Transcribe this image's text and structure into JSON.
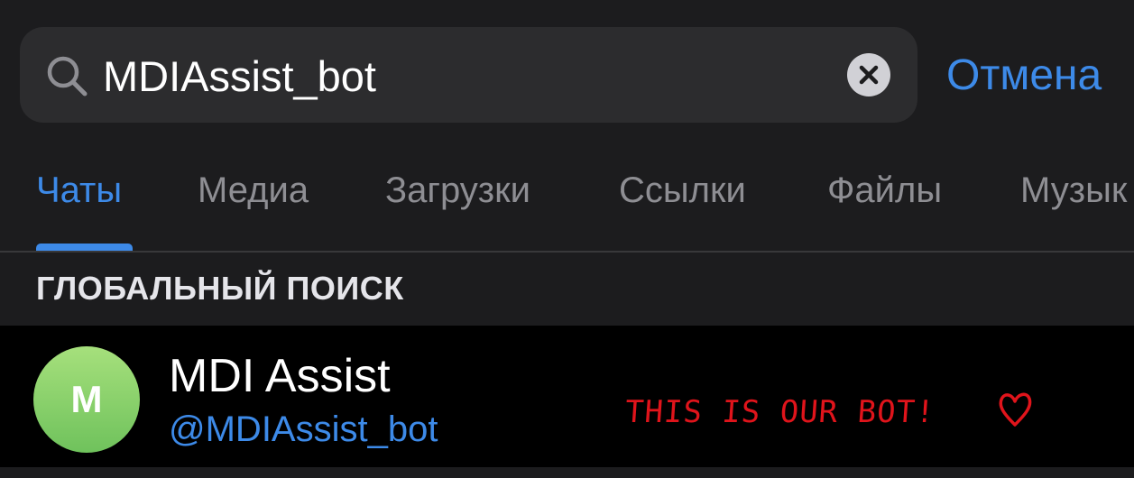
{
  "search": {
    "query": "MDIAssist_bot",
    "cancel_label": "Отмена"
  },
  "tabs": [
    {
      "label": "Чаты",
      "active": true
    },
    {
      "label": "Медиа",
      "active": false
    },
    {
      "label": "Загрузки",
      "active": false
    },
    {
      "label": "Ссылки",
      "active": false
    },
    {
      "label": "Файлы",
      "active": false
    },
    {
      "label": "Музык",
      "active": false
    }
  ],
  "section": {
    "title": "ГЛОБАЛЬНЫЙ ПОИСК"
  },
  "result": {
    "avatar_letter": "M",
    "title": "MDI Assist",
    "username": "@MDIAssist_bot",
    "annotation": "THIS IS OUR BOT!"
  },
  "colors": {
    "accent": "#3d8ae8",
    "background": "#1c1c1e",
    "search_field": "#2c2c2e",
    "row_background": "#000000",
    "inactive_tab": "#8e8e93",
    "annotation": "#e0141b",
    "avatar_gradient_top": "#a6e07c",
    "avatar_gradient_bottom": "#6fc25c"
  }
}
